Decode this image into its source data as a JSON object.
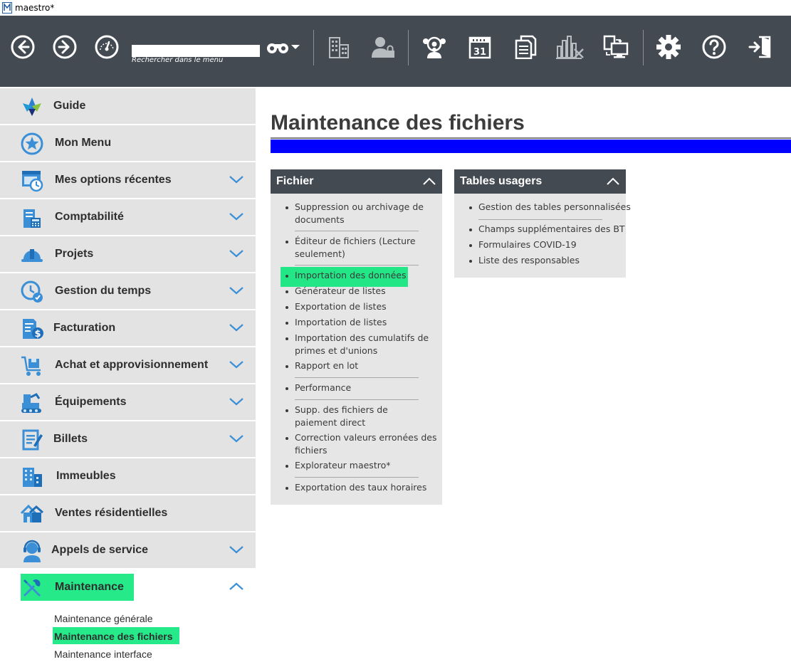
{
  "window": {
    "title": "maestro*"
  },
  "toolbar": {
    "search": {
      "value": "",
      "placeholder": "",
      "hint": "Rechercher dans le menu"
    },
    "buttons": [
      "back-icon",
      "forward-icon",
      "dashboard-icon",
      "binoculars-icon",
      "dropdown-icon",
      "buildings-icon",
      "user-lock-icon",
      "team-icon",
      "calendar-icon",
      "documents-icon",
      "chart-icon",
      "monitor-sync-icon",
      "gear-icon",
      "help-icon",
      "exit-icon"
    ],
    "calendar_day": "31"
  },
  "sidebar": {
    "items": [
      {
        "label": "Guide",
        "icon": "guide-logo-icon",
        "expandable": false
      },
      {
        "label": "Mon Menu",
        "icon": "star-icon",
        "expandable": false
      },
      {
        "label": "Mes options récentes",
        "icon": "recent-icon",
        "expandable": true
      },
      {
        "label": "Comptabilité",
        "icon": "accounting-icon",
        "expandable": true
      },
      {
        "label": "Projets",
        "icon": "hardhat-icon",
        "expandable": true
      },
      {
        "label": "Gestion du temps",
        "icon": "time-icon",
        "expandable": true
      },
      {
        "label": "Facturation",
        "icon": "billing-icon",
        "expandable": true
      },
      {
        "label": "Achat et approvisionnement",
        "icon": "cart-icon",
        "expandable": true
      },
      {
        "label": "Équipements",
        "icon": "equipment-icon",
        "expandable": true
      },
      {
        "label": "Billets",
        "icon": "ticket-icon",
        "expandable": true
      },
      {
        "label": "Immeubles",
        "icon": "building-icon",
        "expandable": false
      },
      {
        "label": "Ventes résidentielles",
        "icon": "houses-icon",
        "expandable": false
      },
      {
        "label": "Appels de service",
        "icon": "headset-icon",
        "expandable": true
      },
      {
        "label": "Maintenance",
        "icon": "tools-icon",
        "expandable": true,
        "expanded": true
      }
    ],
    "sub_items": [
      {
        "label": "Maintenance générale",
        "active": false
      },
      {
        "label": "Maintenance des fichiers",
        "active": true
      },
      {
        "label": "Maintenance interface",
        "active": false
      }
    ]
  },
  "main": {
    "title": "Maintenance des fichiers",
    "panels": [
      {
        "title": "Fichier",
        "links": [
          "Suppression ou archivage de documents",
          "Éditeur de fichiers (Lecture seulement)",
          "Importation des données",
          "Générateur de listes",
          "Exportation de listes",
          "Importation de listes",
          "Importation des cumulatifs de primes et d'unions",
          "Rapport en lot",
          "Performance",
          "Supp. des fichiers de paiement direct",
          "Correction valeurs erronées des fichiers",
          "Explorateur maestro*",
          "Exportation des taux horaires"
        ]
      },
      {
        "title": "Tables usagers",
        "links": [
          "Gestion des tables personnalisées",
          "Champs supplémentaires des BT",
          "Formulaires COVID-19",
          "Liste des responsables"
        ]
      }
    ]
  },
  "colors": {
    "toolbar": "#434a52",
    "sidebar_item": "#e3e3e3",
    "panel": "#e6e6e6",
    "highlight": "#00e676",
    "accent_bar": "#0000ff",
    "icon_blue": "#3a8fd6"
  }
}
